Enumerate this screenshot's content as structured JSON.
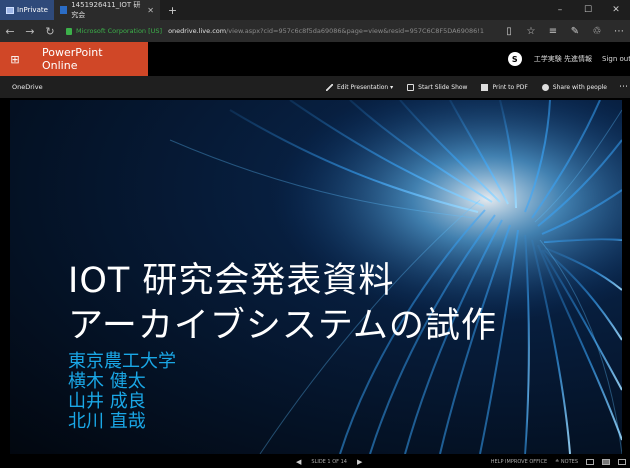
{
  "browser": {
    "inprivate_label": "InPrivate",
    "tab_title": "1451926411_IOT 研究会",
    "tab_close": "✕",
    "new_tab": "+",
    "window_controls": [
      "–",
      "☐",
      "✕"
    ],
    "nav": {
      "back": "←",
      "forward": "→",
      "refresh": "↻"
    },
    "site_identity": "Microsoft Corporation [US]",
    "url_host": "onedrive.live.com",
    "url_rest": "/view.aspx?cid=957c6c8f5da69086&page=view&resid=957C6C8F5DA69086!1",
    "addr_icons": [
      "▯",
      "☆",
      "≡",
      "✎",
      "♲",
      "⋯"
    ]
  },
  "app": {
    "waffle": "⊞",
    "name": "PowerPoint Online",
    "skype": "S",
    "company": "工学実験 先進情報",
    "sign_out": "Sign out"
  },
  "commandbar": {
    "breadcrumb": "OneDrive",
    "edit": "Edit Presentation ▾",
    "slideshow": "Start Slide Show",
    "pdf": "Print to PDF",
    "share": "Share with people",
    "more": "⋯"
  },
  "slide": {
    "title_line1": "IOT 研究会発表資料",
    "title_line2": "アーカイブシステムの試作",
    "subtitle_lines": [
      "東京農工大学",
      "横木 健太",
      "山井 成良",
      "北川 直哉"
    ],
    "accent_color": "#1aa7e6"
  },
  "status": {
    "prev": "◀",
    "slide_counter": "SLIDE 1 OF 14",
    "next": "▶",
    "help": "HELP IMPROVE OFFICE",
    "notes": "≙ NOTES"
  }
}
